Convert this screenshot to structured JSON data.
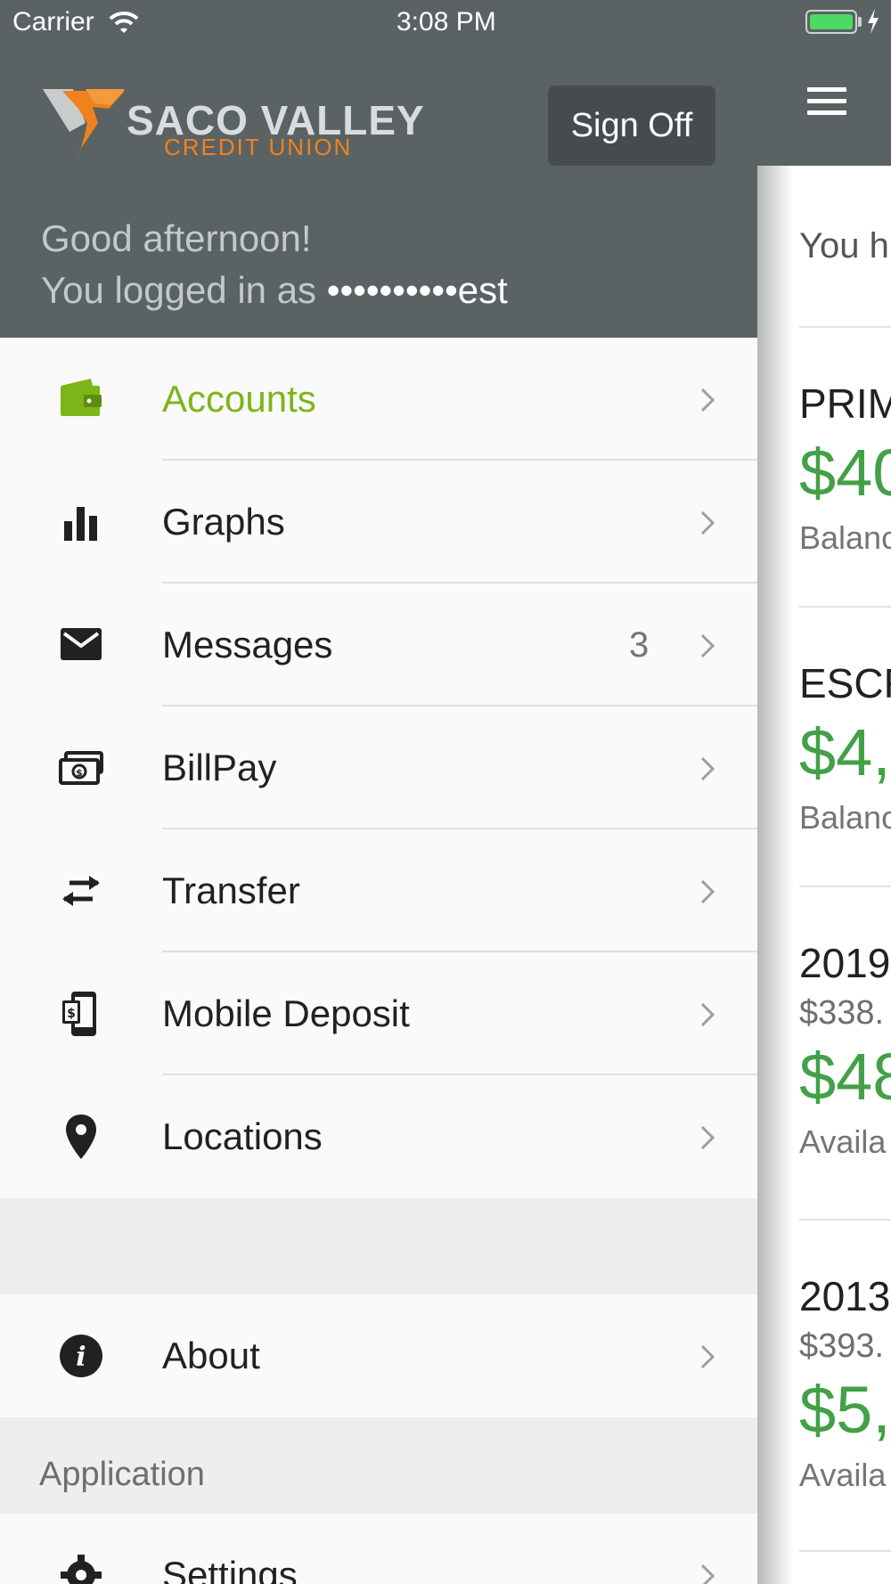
{
  "status_bar": {
    "carrier": "Carrier",
    "time": "3:08 PM",
    "battery_color": "#4cd964"
  },
  "header": {
    "logo_main": "SACO VALLEY",
    "logo_sub": "CREDIT UNION",
    "sign_off_label": "Sign Off",
    "greeting": "Good afternoon!",
    "logged_in_prefix": "You logged in as ",
    "logged_in_user": "••••••••••est"
  },
  "colors": {
    "header_bg": "#5b6264",
    "accent_green": "#7cb518",
    "amount_green": "#43a047",
    "logo_orange": "#f0821e"
  },
  "menu": {
    "items": [
      {
        "label": "Accounts",
        "icon": "wallet-icon",
        "active": true
      },
      {
        "label": "Graphs",
        "icon": "bar-chart-icon"
      },
      {
        "label": "Messages",
        "icon": "envelope-icon",
        "badge": "3"
      },
      {
        "label": "BillPay",
        "icon": "money-icon"
      },
      {
        "label": "Transfer",
        "icon": "transfer-arrows-icon"
      },
      {
        "label": "Mobile Deposit",
        "icon": "mobile-deposit-icon"
      },
      {
        "label": "Locations",
        "icon": "map-pin-icon"
      }
    ],
    "about": {
      "label": "About",
      "icon": "info-icon"
    },
    "application_section": "Application",
    "settings": {
      "label": "Settings",
      "icon": "gear-icon"
    }
  },
  "main": {
    "intro": "You h",
    "accounts": [
      {
        "name": "PRIM",
        "amount": "$40",
        "label": "Balanc"
      },
      {
        "name": "ESCR",
        "amount": "$4,",
        "label": "Balanc"
      },
      {
        "name": "2019",
        "sub": "$338.",
        "amount": "$48",
        "label": "Availa"
      },
      {
        "name": "2013",
        "sub": "$393.",
        "amount": "$5,",
        "label": "Availa"
      }
    ]
  }
}
